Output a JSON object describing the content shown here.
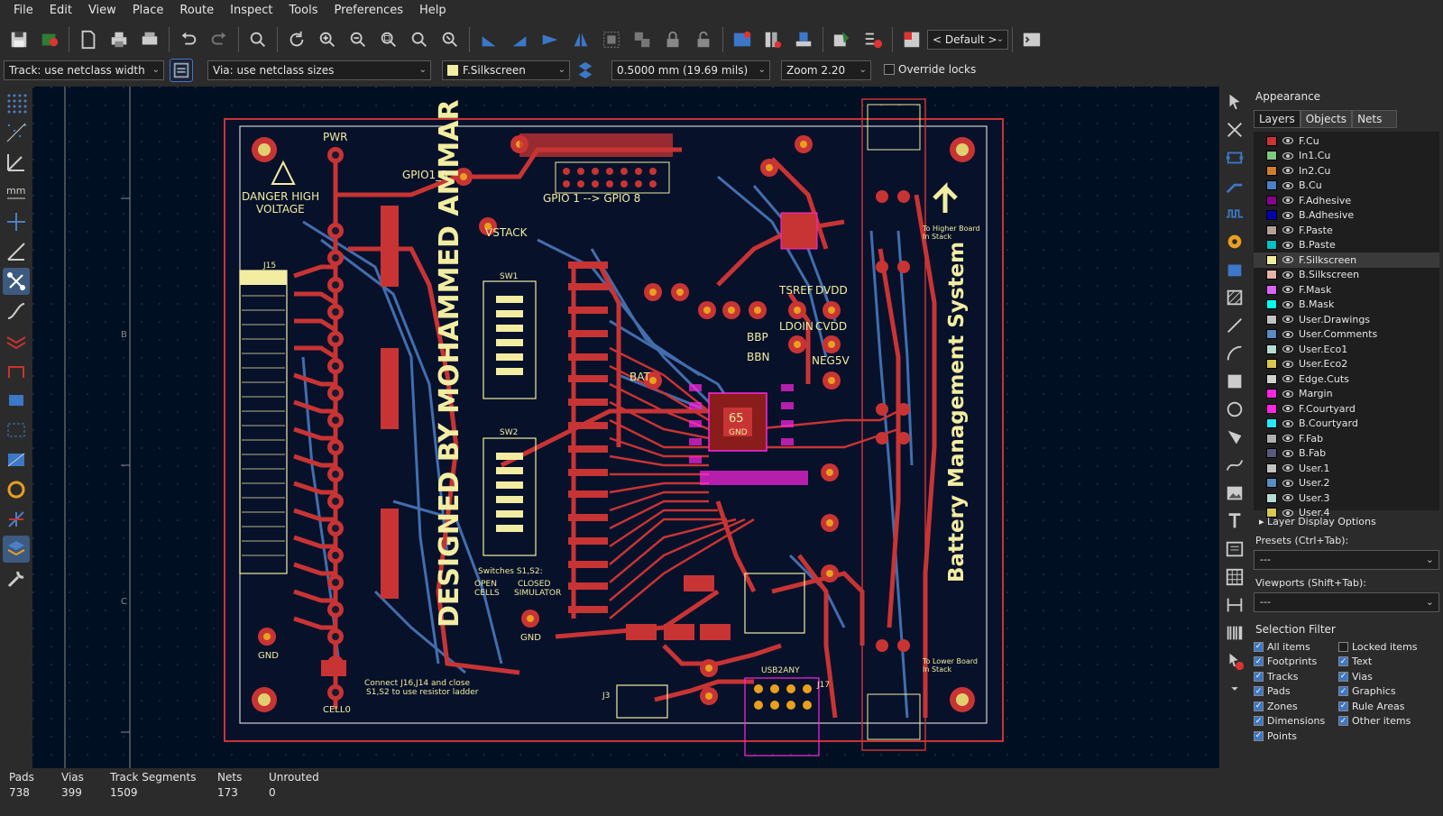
{
  "menu": [
    "File",
    "Edit",
    "View",
    "Place",
    "Route",
    "Inspect",
    "Tools",
    "Preferences",
    "Help"
  ],
  "toolbar": {
    "track_width": "Track: use netclass width",
    "via_size": "Via: use netclass sizes",
    "layer": "F.Silkscreen",
    "grid": "0.5000 mm (19.69 mils)",
    "zoom": "Zoom 2.20",
    "override_locks": "Override locks",
    "view_preset": "< Default >"
  },
  "board": {
    "title": "Battery Management System",
    "designer": "DESIGNED BY MOHAMMED AMMAR",
    "warning_line1": "DANGER HIGH",
    "warning_line2": "VOLTAGE",
    "upper_board": "To Higher Board",
    "upper_board2": "In Stack",
    "lower_board": "To Lower Board",
    "lower_board2": "In Stack",
    "gpio_label": "GPIO 1 --> GPIO 8",
    "gpio1r": "GPIO1_R",
    "vstack": "VSTACK",
    "pwr": "PWR",
    "bat": "BAT",
    "gnd": "GND",
    "gnd2": "GND",
    "cello": "CELL0",
    "neg5v": "NEG5V",
    "ldoin": "LDOIN",
    "cvdd": "CVDD",
    "tsref": "TSREF",
    "dvdd": "DVDD",
    "bbp": "BBP",
    "bbn": "BBN",
    "switches": "Switches S1,S2:",
    "open_cells": "OPEN",
    "open_cells2": "CELLS",
    "closed_sim": "CLOSED",
    "closed_sim2": "SIMULATOR",
    "connect_note": "Connect J16,J14 and close",
    "connect_note2": "S1,S2 to use resistor ladder",
    "usb": "USB2ANY",
    "chip": "65",
    "chip_sub": "GND",
    "sw1": "SW1",
    "sw2": "SW2",
    "j15": "J15",
    "j3": "J3",
    "j17": "J17"
  },
  "appearance": {
    "title": "Appearance",
    "tabs": [
      "Layers",
      "Objects",
      "Nets"
    ],
    "layers": [
      {
        "name": "F.Cu",
        "color": "#c83434"
      },
      {
        "name": "In1.Cu",
        "color": "#7fc87f"
      },
      {
        "name": "In2.Cu",
        "color": "#ce7d2c"
      },
      {
        "name": "B.Cu",
        "color": "#4d7fc4"
      },
      {
        "name": "F.Adhesive",
        "color": "#84008a"
      },
      {
        "name": "B.Adhesive",
        "color": "#0000b0"
      },
      {
        "name": "F.Paste",
        "color": "#b4a09a"
      },
      {
        "name": "B.Paste",
        "color": "#00c2c2"
      },
      {
        "name": "F.Silkscreen",
        "color": "#f2eda1"
      },
      {
        "name": "B.Silkscreen",
        "color": "#e8b2a7"
      },
      {
        "name": "F.Mask",
        "color": "#d864ff"
      },
      {
        "name": "B.Mask",
        "color": "#02ffee"
      },
      {
        "name": "User.Drawings",
        "color": "#c2c2c2"
      },
      {
        "name": "User.Comments",
        "color": "#598bc4"
      },
      {
        "name": "User.Eco1",
        "color": "#b5dbd2"
      },
      {
        "name": "User.Eco2",
        "color": "#d8c852"
      },
      {
        "name": "Edge.Cuts",
        "color": "#d0d2cd"
      },
      {
        "name": "Margin",
        "color": "#ff26e2"
      },
      {
        "name": "F.Courtyard",
        "color": "#ff26e2"
      },
      {
        "name": "B.Courtyard",
        "color": "#26e9ff"
      },
      {
        "name": "F.Fab",
        "color": "#afafaf"
      },
      {
        "name": "B.Fab",
        "color": "#58597c"
      },
      {
        "name": "User.1",
        "color": "#c2c2c2"
      },
      {
        "name": "User.2",
        "color": "#598bc4"
      },
      {
        "name": "User.3",
        "color": "#b5dbd2"
      },
      {
        "name": "User.4",
        "color": "#d8c852"
      }
    ],
    "layer_display_options": "Layer Display Options",
    "presets_label": "Presets (Ctrl+Tab):",
    "presets_value": "---",
    "viewports_label": "Viewports (Shift+Tab):",
    "viewports_value": "---"
  },
  "selection_filter": {
    "title": "Selection Filter",
    "items": [
      {
        "label": "All items",
        "checked": true
      },
      {
        "label": "Locked items",
        "checked": false
      },
      {
        "label": "Footprints",
        "checked": true
      },
      {
        "label": "Text",
        "checked": true
      },
      {
        "label": "Tracks",
        "checked": true
      },
      {
        "label": "Vias",
        "checked": true
      },
      {
        "label": "Pads",
        "checked": true
      },
      {
        "label": "Graphics",
        "checked": true
      },
      {
        "label": "Zones",
        "checked": true
      },
      {
        "label": "Rule Areas",
        "checked": true
      },
      {
        "label": "Dimensions",
        "checked": true
      },
      {
        "label": "Other items",
        "checked": true
      },
      {
        "label": "Points",
        "checked": true
      }
    ]
  },
  "status": {
    "pads_label": "Pads",
    "pads": "738",
    "vias_label": "Vias",
    "vias": "399",
    "tracks_label": "Track Segments",
    "tracks": "1509",
    "nets_label": "Nets",
    "nets": "173",
    "unrouted_label": "Unrouted",
    "unrouted": "0"
  },
  "colors": {
    "fcu": "#c83434",
    "bcu": "#4d7fc4",
    "silk": "#f2eda1",
    "edge": "#d0d2cd",
    "courtyard": "#ff26e2",
    "canvas": "#001023"
  }
}
